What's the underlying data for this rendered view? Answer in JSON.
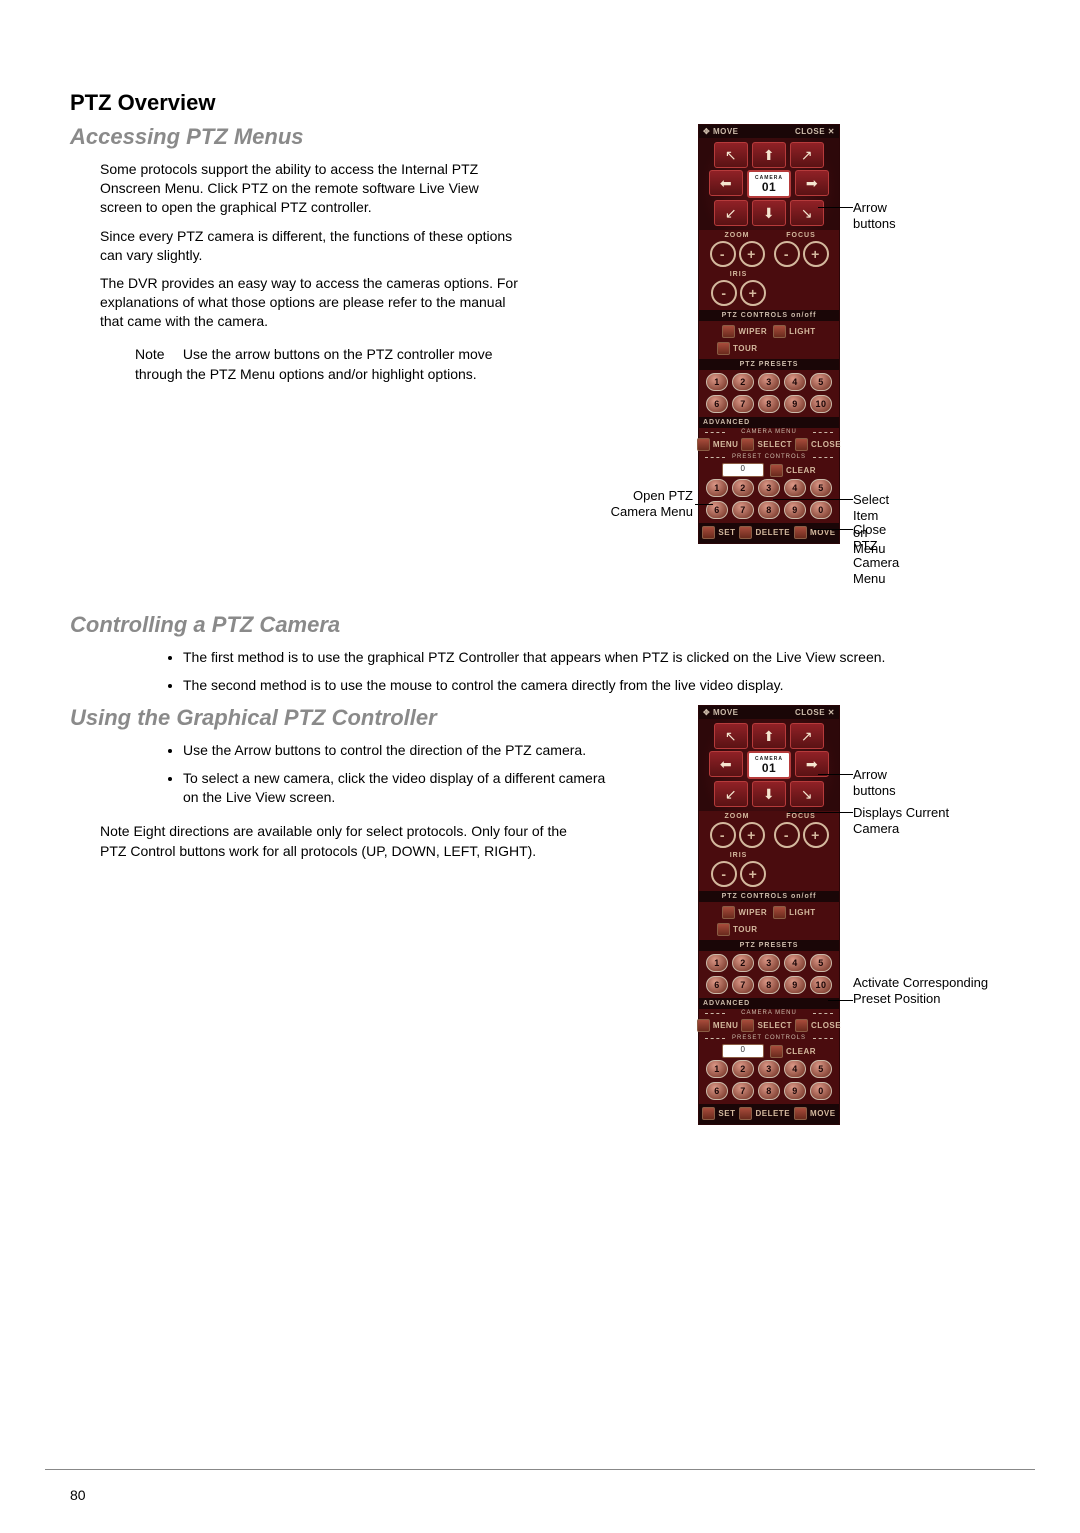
{
  "headings": {
    "h1": "PTZ Overview",
    "h2a": "Accessing PTZ Menus",
    "h2b": "Controlling a PTZ Camera",
    "h2c": "Using the Graphical PTZ Controller"
  },
  "paras": {
    "p1": "Some protocols support the ability to access the Internal PTZ Onscreen Menu. Click PTZ on the remote software Live View screen to open the graphical PTZ controller.",
    "p2": "Since every PTZ camera is different, the functions of these options can vary slightly.",
    "p3": "The DVR provides an easy way to access the cameras options. For explanations of what those options are please refer to the manual that came with the camera."
  },
  "note1": {
    "label": "Note",
    "text": "Use the arrow buttons on the PTZ controller move through the PTZ Menu options and/or highlight options."
  },
  "bullets_b": [
    "The first method is to use the graphical PTZ Controller that appears when PTZ is clicked on the Live View screen.",
    "The second method is to use the mouse to control the camera directly from the live video display."
  ],
  "bullets_c": [
    "Use the Arrow buttons to control the direction of the PTZ camera.",
    "To select a new camera, click the video display of a different camera on the Live View screen."
  ],
  "note2": {
    "label": "Note",
    "text": "Eight directions are available only for select protocols. Only four of the PTZ Control buttons work for all protocols (UP, DOWN, LEFT, RIGHT)."
  },
  "ptz": {
    "move": "MOVE",
    "close": "CLOSE",
    "camera_label": "CAMERA",
    "camera_num": "01",
    "zoom": "ZOOM",
    "focus": "FOCUS",
    "iris": "IRIS",
    "controls_bar": "PTZ CONTROLS  on/off",
    "wiper": "WIPER",
    "light": "LIGHT",
    "tour": "TOUR",
    "presets_bar": "PTZ PRESETS",
    "presets_row1": [
      "1",
      "2",
      "3",
      "4",
      "5"
    ],
    "presets_row2": [
      "6",
      "7",
      "8",
      "9",
      "10"
    ],
    "advanced": "ADVANCED",
    "camera_menu_bar": "CAMERA MENU",
    "menu": "MENU",
    "select": "SELECT",
    "close2": "CLOSE",
    "preset_controls_bar": "PRESET CONTROLS",
    "input_val": "0",
    "clear": "CLEAR",
    "pc_row1": [
      "1",
      "2",
      "3",
      "4",
      "5"
    ],
    "pc_row2": [
      "6",
      "7",
      "8",
      "9",
      "0"
    ],
    "set": "SET",
    "delete": "DELETE",
    "move2": "MOVE"
  },
  "callouts": {
    "arrow_buttons": "Arrow buttons",
    "open_menu": "Open PTZ Camera Menu",
    "select_item": "Select Item on Menu",
    "close_menu": "Close PTZ Camera Menu",
    "disp_current": "Displays Current Camera",
    "activate_preset": "Activate Corresponding Preset Position"
  },
  "page_number": "80"
}
